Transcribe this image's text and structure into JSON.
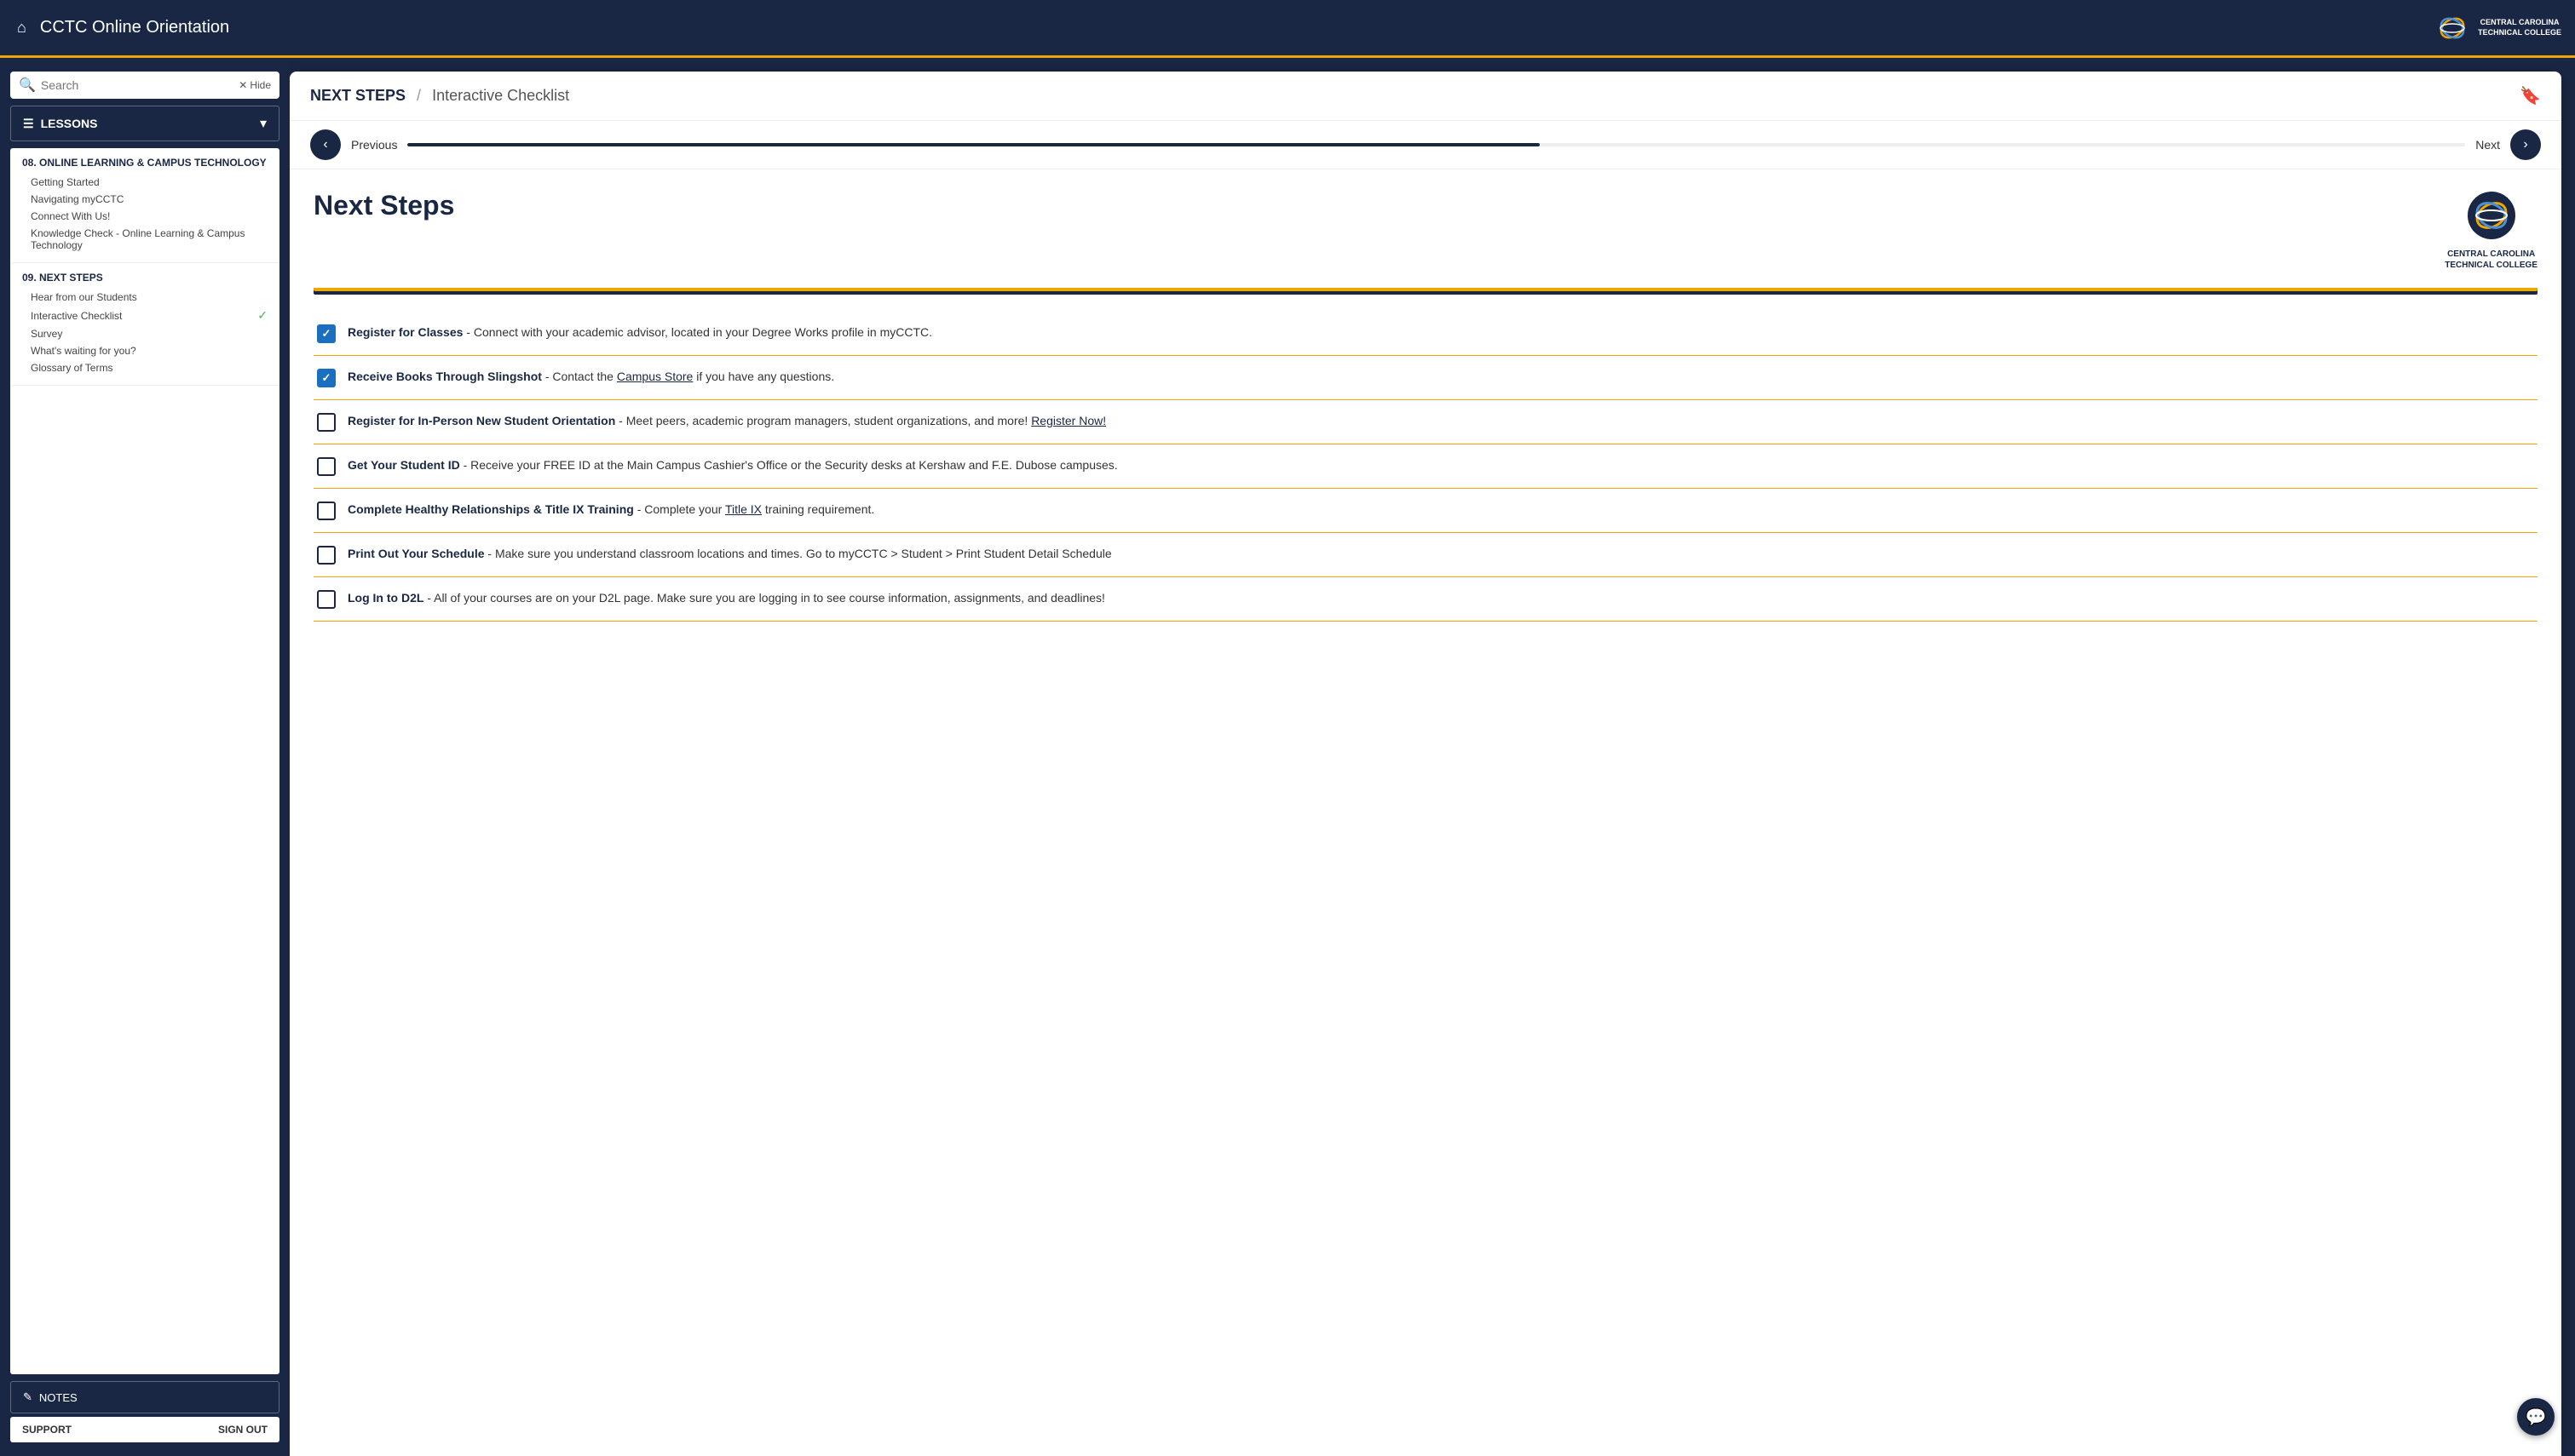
{
  "header": {
    "home_icon": "⌂",
    "title": "CCTC Online Orientation",
    "logo_text": "CENTRAL CAROLINA\nTECHNICAL COLLEGE"
  },
  "sidebar": {
    "search_placeholder": "Search",
    "hide_label": "Hide",
    "lessons_label": "LESSONS",
    "sections": [
      {
        "id": "section-08",
        "title": "08. ONLINE LEARNING & CAMPUS TECHNOLOGY",
        "items": [
          {
            "label": "Getting Started",
            "checked": false
          },
          {
            "label": "Navigating myCCTC",
            "checked": false
          },
          {
            "label": "Connect With Us!",
            "checked": false
          },
          {
            "label": "Knowledge Check - Online Learning & Campus Technology",
            "checked": false
          }
        ]
      },
      {
        "id": "section-09",
        "title": "09. NEXT STEPS",
        "items": [
          {
            "label": "Hear from our Students",
            "checked": false
          },
          {
            "label": "Interactive Checklist",
            "checked": true
          },
          {
            "label": "Survey",
            "checked": false
          },
          {
            "label": "What's waiting for you?",
            "checked": false
          },
          {
            "label": "Glossary of Terms",
            "checked": false
          }
        ]
      }
    ],
    "notes_label": "NOTES",
    "support_label": "SUPPORT",
    "sign_out_label": "SIGN OUT"
  },
  "breadcrumb": {
    "section": "NEXT STEPS",
    "divider": "/",
    "page": "Interactive Checklist"
  },
  "nav": {
    "prev_label": "Previous",
    "next_label": "Next",
    "progress_pct": 55
  },
  "content": {
    "title": "Next Steps",
    "logo_name": "CENTRAL CAROLINA\nTECHNICAL COLLEGE",
    "checklist_items": [
      {
        "id": "item-1",
        "checked": true,
        "bold": "Register for Classes",
        "text": " - Connect with your academic advisor, located in your Degree Works profile in myCCTC."
      },
      {
        "id": "item-2",
        "checked": true,
        "bold": "Receive Books Through Slingshot",
        "text": " - Contact the ",
        "link": "Campus Store",
        "text_after": " if you have any questions."
      },
      {
        "id": "item-3",
        "checked": false,
        "bold": "Register for In-Person New Student Orientation",
        "text": " - Meet peers, academic program managers, student organizations, and more! ",
        "link": "Register Now!"
      },
      {
        "id": "item-4",
        "checked": false,
        "bold": "Get Your Student ID",
        "text": " - Receive your FREE ID at the Main Campus Cashier's Office or the Security desks at Kershaw and F.E. Dubose campuses."
      },
      {
        "id": "item-5",
        "checked": false,
        "bold": "Complete Healthy Relationships & Title IX Training",
        "text": " - Complete your ",
        "link": "Title IX",
        "text_after": " training requirement."
      },
      {
        "id": "item-6",
        "checked": false,
        "bold": "Print Out Your Schedule",
        "text": " - Make sure you understand classroom locations and times. Go to myCCTC > Student > Print Student Detail Schedule"
      },
      {
        "id": "item-7",
        "checked": false,
        "bold": "Log In to D2L",
        "text": " - All of your courses are on your D2L page. Make sure you are logging in to see course information, assignments, and deadlines!"
      }
    ]
  }
}
